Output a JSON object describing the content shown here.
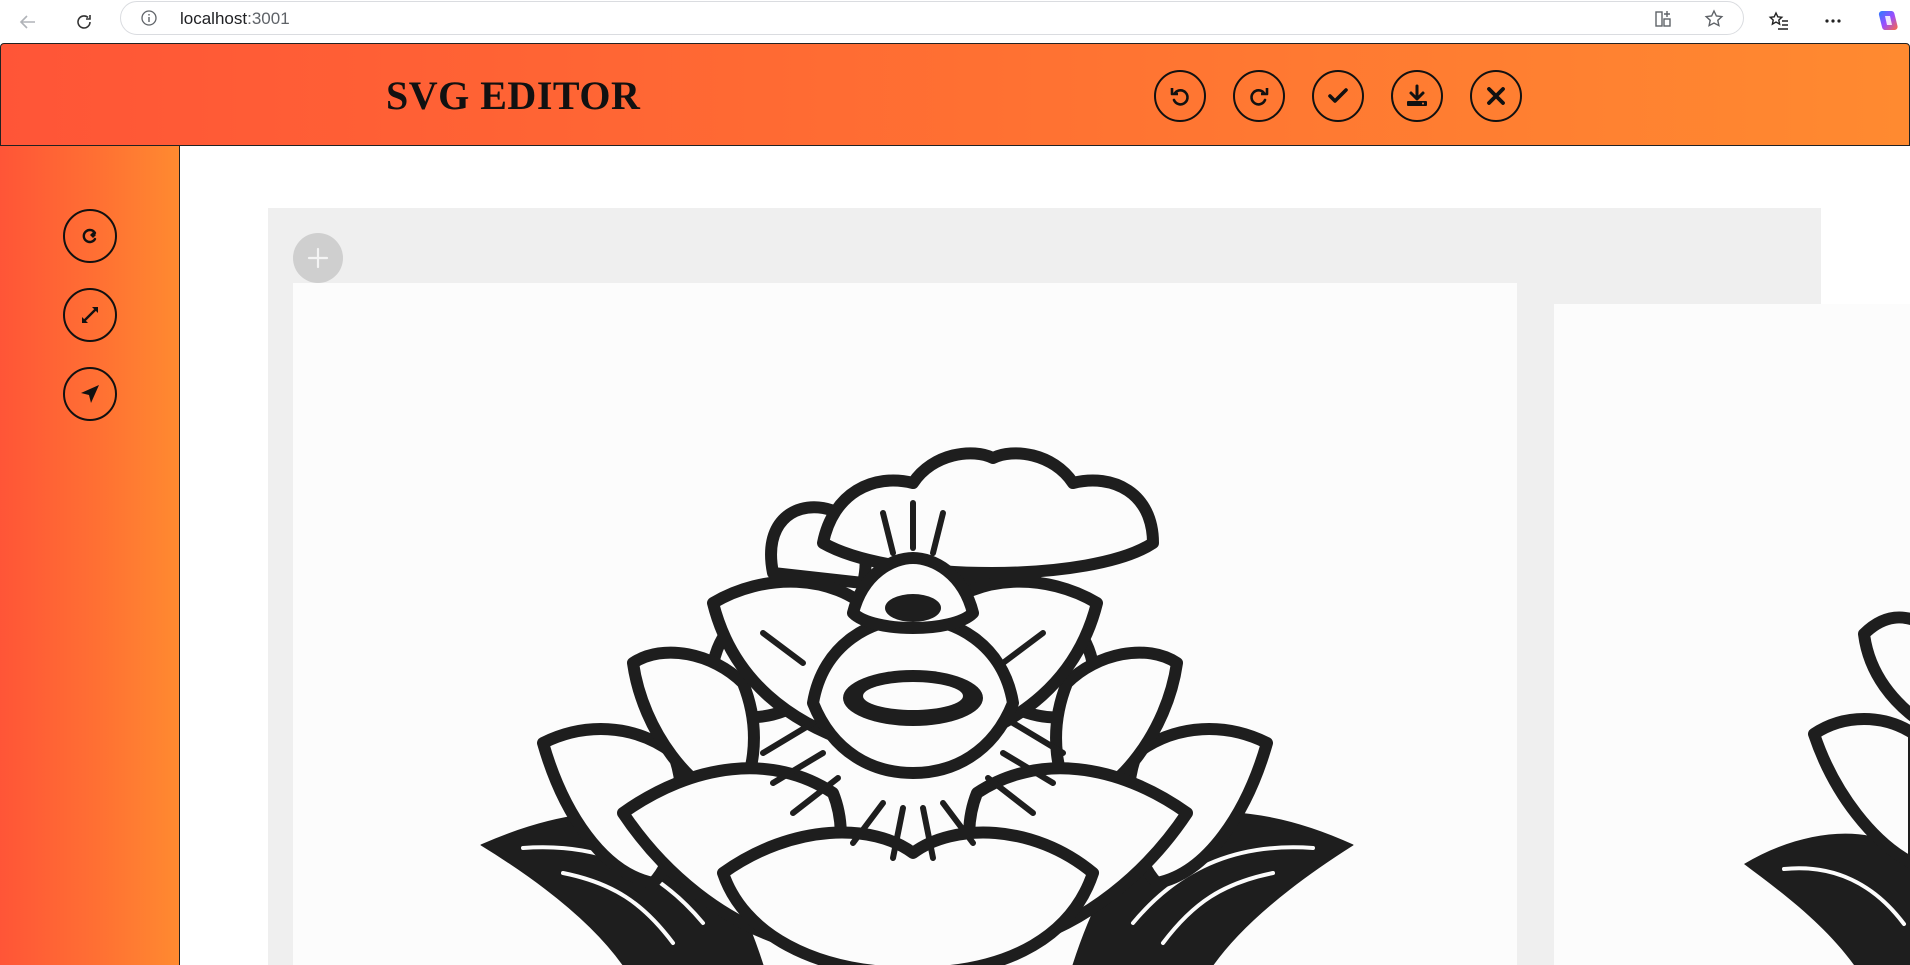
{
  "browser": {
    "url_host": "localhost",
    "url_port": ":3001"
  },
  "app": {
    "title": "SVG EDITOR"
  },
  "header_buttons": [
    {
      "name": "undo-button",
      "icon": "undo-icon"
    },
    {
      "name": "redo-button",
      "icon": "redo-icon"
    },
    {
      "name": "apply-button",
      "icon": "check-icon"
    },
    {
      "name": "download-button",
      "icon": "download-icon"
    },
    {
      "name": "close-button",
      "icon": "close-icon"
    }
  ],
  "sidebar_tools": [
    {
      "name": "rotate-tool-button",
      "icon": "rotate-icon"
    },
    {
      "name": "resize-tool-button",
      "icon": "expand-arrows-icon"
    },
    {
      "name": "move-tool-button",
      "icon": "location-arrow-icon"
    }
  ],
  "colors": {
    "header_gradient_start": "#ff5537",
    "header_gradient_end": "#ff8a30",
    "panel_background": "#efefef",
    "add_button": "#cfcfcf",
    "artwork": "#1e1e1e"
  }
}
